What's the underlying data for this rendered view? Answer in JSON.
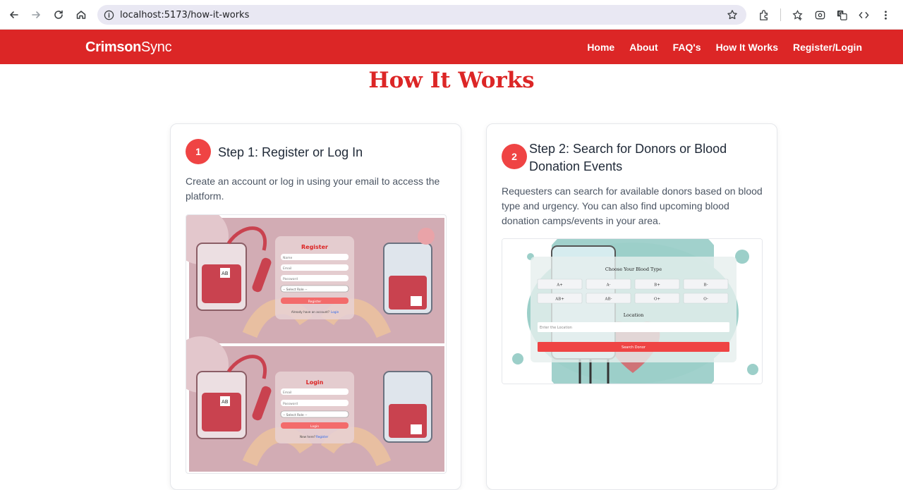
{
  "browser": {
    "url": "localhost:5173/how-it-works"
  },
  "header": {
    "brand_bold": "Crimson",
    "brand_light": "Sync",
    "nav": [
      "Home",
      "About",
      "FAQ's",
      "How It Works",
      "Register/Login"
    ]
  },
  "page": {
    "title": "How It Works"
  },
  "steps": [
    {
      "number": "1",
      "title": "Step 1: Register or Log In",
      "description": "Create an account or log in using your email to access the platform.",
      "register_form": {
        "title": "Register",
        "fields": [
          "Name",
          "Email",
          "Password"
        ],
        "select": "-- Select Role --",
        "button": "Register",
        "footer": "Already have an account?",
        "footer_link": "Login"
      },
      "login_form": {
        "title": "Login",
        "fields": [
          "Email",
          "Password"
        ],
        "select": "-- Select Role --",
        "button": "Login",
        "footer": "New here?",
        "footer_link": "Register"
      }
    },
    {
      "number": "2",
      "title": "Step 2: Search for Donors or Blood Donation Events",
      "description": "Requesters can search for available donors based on blood type and urgency. You can also find upcoming blood donation camps/events in your area.",
      "search_form": {
        "heading": "Choose Your Blood Type",
        "blood_types": [
          "A+",
          "A-",
          "B+",
          "B-",
          "AB+",
          "AB-",
          "O+",
          "O-"
        ],
        "location_label": "Location",
        "location_placeholder": "Enter the Location",
        "button": "Search Donor"
      }
    }
  ]
}
